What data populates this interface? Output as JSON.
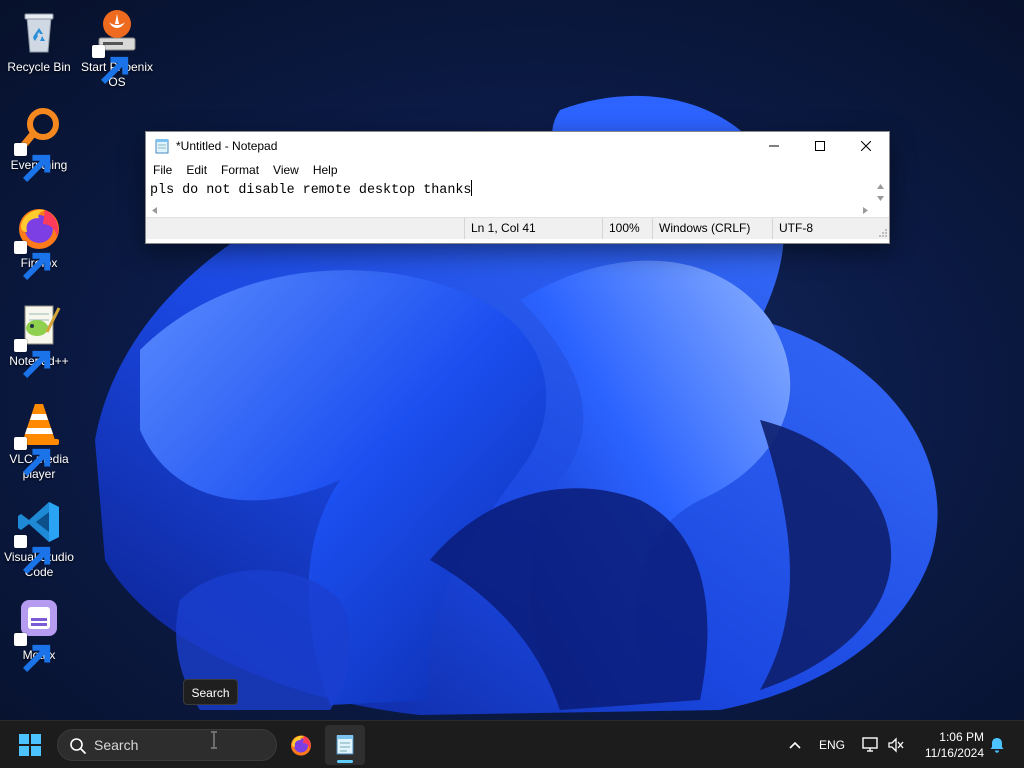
{
  "desktop": {
    "icons": [
      {
        "label": "Recycle Bin"
      },
      {
        "label": "Start Phoenix OS"
      },
      {
        "label": "Everything"
      },
      {
        "label": "Firefox"
      },
      {
        "label": "Notepad++"
      },
      {
        "label": "VLC media player"
      },
      {
        "label": "Visual Studio Code"
      },
      {
        "label": "Motrix"
      }
    ]
  },
  "notepad": {
    "title": "*Untitled - Notepad",
    "menu": [
      "File",
      "Edit",
      "Format",
      "View",
      "Help"
    ],
    "content": "pls do not disable remote desktop thanks",
    "status": {
      "position": "Ln 1, Col 41",
      "zoom": "100%",
      "line_ending": "Windows (CRLF)",
      "encoding": "UTF-8"
    }
  },
  "tooltip": {
    "text": "Search"
  },
  "taskbar": {
    "search_placeholder": "Search",
    "language": "ENG",
    "time": "1:06 PM",
    "date": "11/16/2024"
  },
  "colors": {
    "accent": "#60cdff",
    "wallpaper_dark": "#0a1430",
    "wallpaper_bloom": "#1f55ff"
  }
}
